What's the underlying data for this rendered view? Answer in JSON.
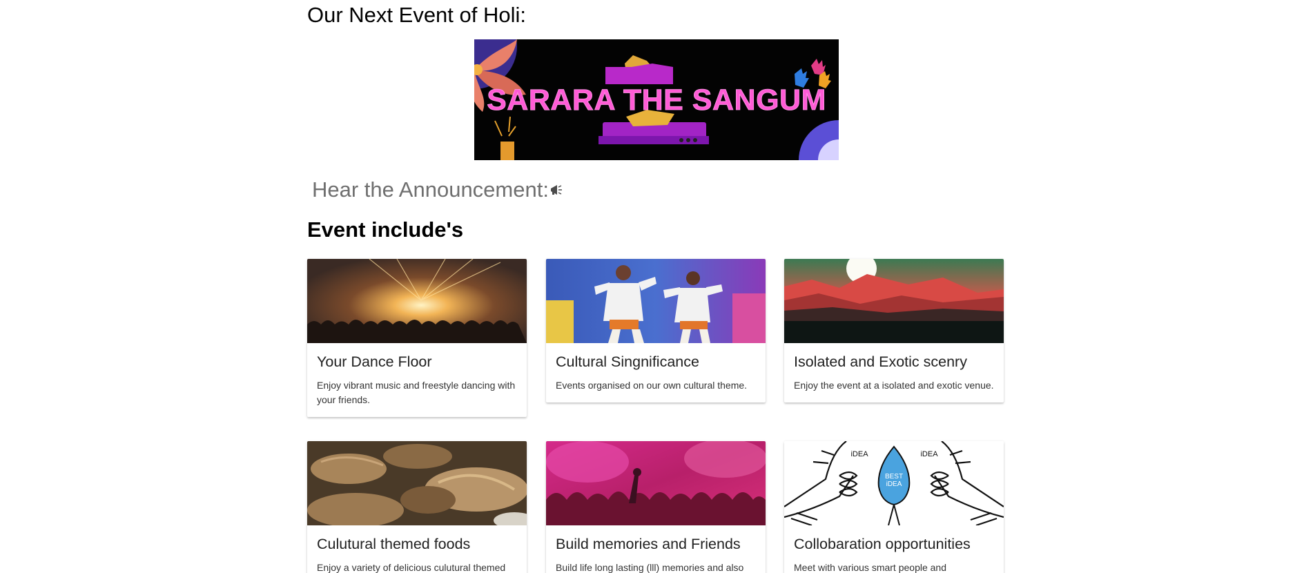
{
  "heading_next_event": "Our Next Event of Holi:",
  "banner": {
    "text": "SARARA THE SANGUM"
  },
  "announcement": {
    "label": "Hear the Announcement:",
    "icon": "megaphone-icon"
  },
  "heading_includes": "Event include's",
  "cards": [
    {
      "title": "Your Dance Floor",
      "text": "Enjoy vibrant music and freestyle dancing with your friends.",
      "image": "concert-stage-lights"
    },
    {
      "title": "Cultural Singnificance",
      "text": "Events organised on our own cultural theme.",
      "image": "folk-dancers"
    },
    {
      "title": "Isolated and Exotic scenry",
      "text": "Enjoy the event at a isolated and exotic venue.",
      "image": "red-mountains-landscape"
    },
    {
      "title": "Culutural themed foods",
      "text": "Enjoy a variety of delicious culutural themed",
      "image": "gujiya-sweets"
    },
    {
      "title": "Build memories and Friends",
      "text": "Build life long lasting (lll) memories and also",
      "image": "holi-color-crowd"
    },
    {
      "title": "Collobaration opportunities",
      "text": "Meet with various smart people and",
      "image": "best-idea-illustration",
      "image_labels": {
        "left": "iDEA",
        "right": "iDEA",
        "center_line1": "BEST",
        "center_line2": "iDEA"
      }
    }
  ],
  "colors": {
    "banner_neon": "#ff4fd8",
    "announce_text": "#6f6f6f",
    "card_shadow": "#d0d0d0"
  }
}
